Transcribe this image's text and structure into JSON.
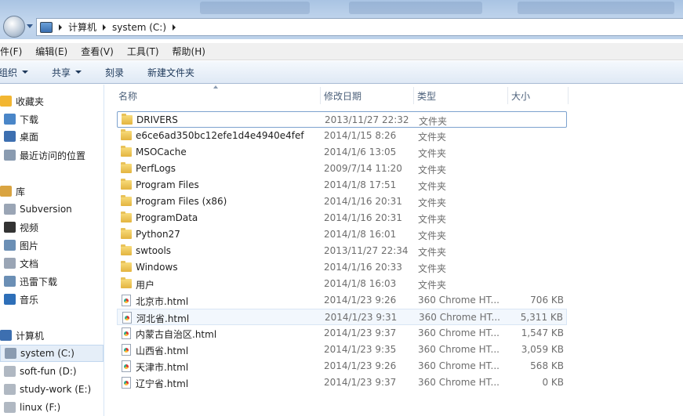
{
  "address": {
    "crumbs": [
      "计算机",
      "system (C:)"
    ]
  },
  "menu": [
    "件(F)",
    "编辑(E)",
    "查看(V)",
    "工具(T)",
    "帮助(H)"
  ],
  "toolbar": {
    "organize": "组织",
    "share": "共享",
    "burn": "刻录",
    "new_folder": "新建文件夹"
  },
  "sidebar": [
    {
      "label": "收藏夹",
      "icon": "star-icon",
      "color": "#f2b632"
    },
    {
      "label": "下载",
      "icon": "download-folder-icon",
      "color": "#4a86c8"
    },
    {
      "label": "桌面",
      "icon": "desktop-icon",
      "color": "#3d6fb0"
    },
    {
      "label": "最近访问的位置",
      "icon": "recent-places-icon",
      "color": "#8a9bb0"
    },
    {
      "label": "库",
      "icon": "library-icon",
      "color": "#d9a441"
    },
    {
      "label": "Subversion",
      "icon": "document-library-icon",
      "color": "#9aa5b5"
    },
    {
      "label": "视频",
      "icon": "video-icon",
      "color": "#333333"
    },
    {
      "label": "图片",
      "icon": "pictures-icon",
      "color": "#6b8fb5"
    },
    {
      "label": "文档",
      "icon": "documents-icon",
      "color": "#9aa5b5"
    },
    {
      "label": "迅雷下载",
      "icon": "download-library-icon",
      "color": "#6b8fb5"
    },
    {
      "label": "音乐",
      "icon": "music-icon",
      "color": "#2e6fb8"
    },
    {
      "label": "计算机",
      "icon": "computer-icon",
      "color": "#3d6fb0"
    },
    {
      "label": "system (C:)",
      "icon": "system-drive-icon",
      "color": "#8a9bb0",
      "selected": true
    },
    {
      "label": "soft-fun (D:)",
      "icon": "drive-icon",
      "color": "#b0b8c2"
    },
    {
      "label": "study-work (E:)",
      "icon": "drive-icon",
      "color": "#b0b8c2"
    },
    {
      "label": "linux (F:)",
      "icon": "drive-icon",
      "color": "#b0b8c2"
    }
  ],
  "columns": [
    "名称",
    "修改日期",
    "类型",
    "大小"
  ],
  "files": [
    {
      "name": "DRIVERS",
      "date": "2013/11/27 22:32",
      "type": "文件夹",
      "size": "",
      "kind": "folder",
      "state": "focused"
    },
    {
      "name": "e6ce6ad350bc12efe1d4e4940e4fef",
      "date": "2014/1/15 8:26",
      "type": "文件夹",
      "size": "",
      "kind": "folder"
    },
    {
      "name": "MSOCache",
      "date": "2014/1/6 13:05",
      "type": "文件夹",
      "size": "",
      "kind": "folder"
    },
    {
      "name": "PerfLogs",
      "date": "2009/7/14 11:20",
      "type": "文件夹",
      "size": "",
      "kind": "folder"
    },
    {
      "name": "Program Files",
      "date": "2014/1/8 17:51",
      "type": "文件夹",
      "size": "",
      "kind": "folder"
    },
    {
      "name": "Program Files (x86)",
      "date": "2014/1/16 20:31",
      "type": "文件夹",
      "size": "",
      "kind": "folder"
    },
    {
      "name": "ProgramData",
      "date": "2014/1/16 20:31",
      "type": "文件夹",
      "size": "",
      "kind": "folder"
    },
    {
      "name": "Python27",
      "date": "2014/1/8 16:01",
      "type": "文件夹",
      "size": "",
      "kind": "folder"
    },
    {
      "name": "swtools",
      "date": "2013/11/27 22:34",
      "type": "文件夹",
      "size": "",
      "kind": "folder"
    },
    {
      "name": "Windows",
      "date": "2014/1/16 20:33",
      "type": "文件夹",
      "size": "",
      "kind": "folder"
    },
    {
      "name": "用户",
      "date": "2014/1/8 16:03",
      "type": "文件夹",
      "size": "",
      "kind": "folder"
    },
    {
      "name": "北京市.html",
      "date": "2014/1/23 9:26",
      "type": "360 Chrome HT...",
      "size": "706 KB",
      "kind": "html"
    },
    {
      "name": "河北省.html",
      "date": "2014/1/23 9:31",
      "type": "360 Chrome HT...",
      "size": "5,311 KB",
      "kind": "html",
      "state": "hover"
    },
    {
      "name": "内蒙古自治区.html",
      "date": "2014/1/23 9:37",
      "type": "360 Chrome HT...",
      "size": "1,547 KB",
      "kind": "html"
    },
    {
      "name": "山西省.html",
      "date": "2014/1/23 9:35",
      "type": "360 Chrome HT...",
      "size": "3,059 KB",
      "kind": "html"
    },
    {
      "name": "天津市.html",
      "date": "2014/1/23 9:26",
      "type": "360 Chrome HT...",
      "size": "568 KB",
      "kind": "html"
    },
    {
      "name": "辽宁省.html",
      "date": "2014/1/23 9:37",
      "type": "360 Chrome HT...",
      "size": "0 KB",
      "kind": "html"
    }
  ]
}
